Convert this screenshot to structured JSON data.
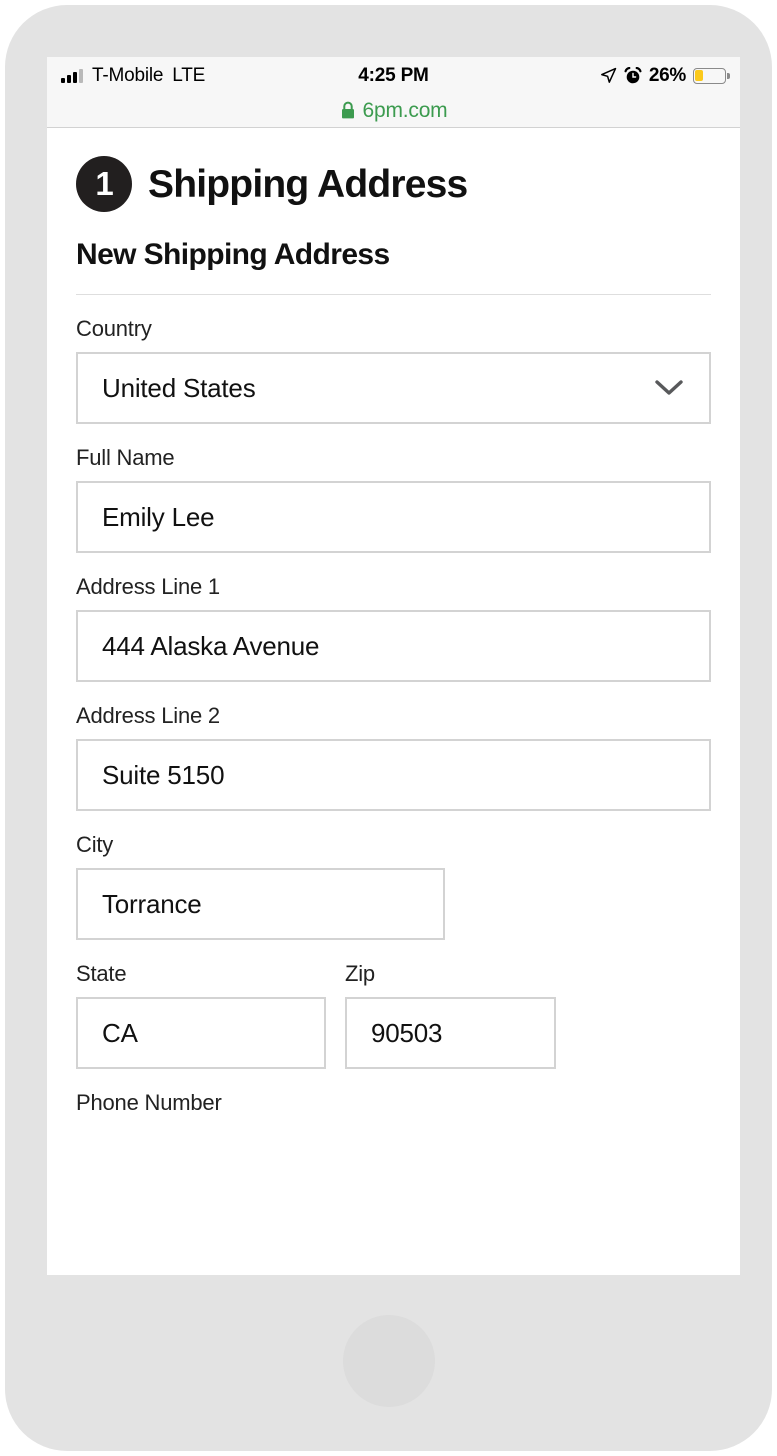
{
  "status_bar": {
    "carrier": "T-Mobile",
    "network_type": "LTE",
    "time": "4:25 PM",
    "battery_percent": "26%",
    "battery_level": 26,
    "signal_bars_filled": 3,
    "signal_bars_total": 4,
    "icons": [
      "signal-bars-icon",
      "location-arrow-icon",
      "alarm-clock-icon",
      "battery-icon"
    ]
  },
  "browser": {
    "lock_icon": "lock-icon",
    "url": "6pm.com",
    "secure_color": "#3c9b4f"
  },
  "checkout": {
    "step_number": "1",
    "step_title": "Shipping Address",
    "section_subtitle": "New Shipping Address"
  },
  "form": {
    "country": {
      "label": "Country",
      "value": "United States",
      "dropdown_icon": "chevron-down-icon"
    },
    "full_name": {
      "label": "Full Name",
      "value": "Emily Lee"
    },
    "address_line_1": {
      "label": "Address Line 1",
      "value": "444 Alaska Avenue"
    },
    "address_line_2": {
      "label": "Address Line 2",
      "value": "Suite 5150"
    },
    "city": {
      "label": "City",
      "value": "Torrance"
    },
    "state": {
      "label": "State",
      "value": "CA"
    },
    "zip": {
      "label": "Zip",
      "value": "90503"
    },
    "phone_number": {
      "label": "Phone Number"
    }
  },
  "colors": {
    "badge_bg": "#221f1f",
    "input_border": "#d3d3d3",
    "battery_fill": "#fbc91b",
    "device_body": "#e3e3e3"
  }
}
